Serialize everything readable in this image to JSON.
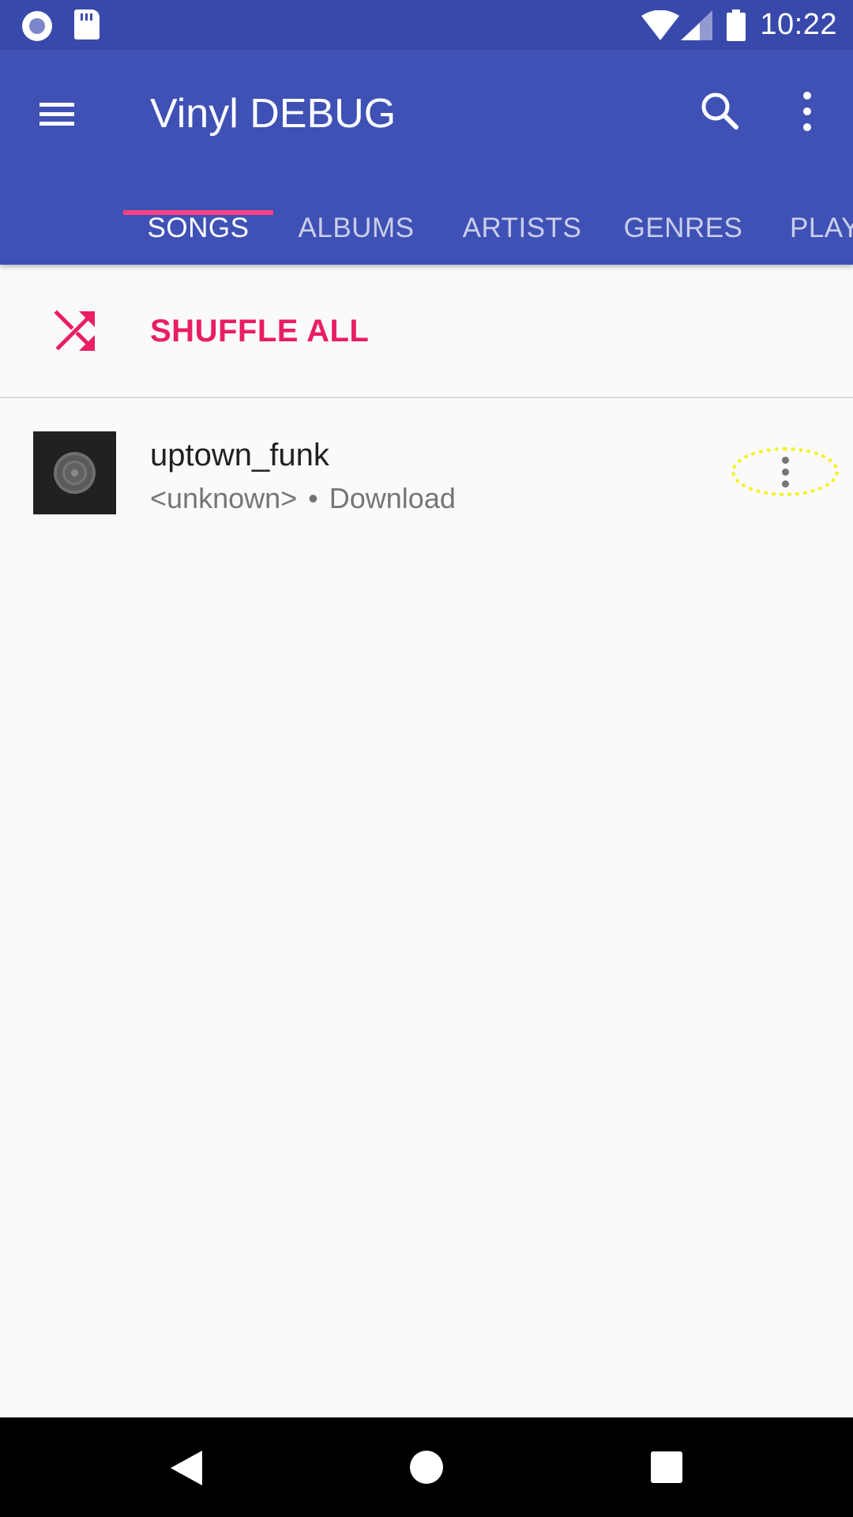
{
  "status_bar": {
    "time": "10:22",
    "left_icons": [
      "media-notification-icon",
      "sd-card-icon"
    ],
    "right_icons": [
      "wifi-icon",
      "signal-icon",
      "battery-icon"
    ]
  },
  "app_bar": {
    "title": "Vinyl DEBUG",
    "menu_icon": "menu-icon",
    "search_icon": "search-icon",
    "overflow_icon": "more-vert-icon",
    "tabs": [
      {
        "label": "SONGS",
        "active": true
      },
      {
        "label": "ALBUMS",
        "active": false
      },
      {
        "label": "ARTISTS",
        "active": false
      },
      {
        "label": "GENRES",
        "active": false
      },
      {
        "label": "PLAYLISTS",
        "active": false
      }
    ]
  },
  "shuffle": {
    "label": "SHUFFLE ALL",
    "icon": "shuffle-icon"
  },
  "songs": [
    {
      "title": "uptown_funk",
      "artist": "<unknown>",
      "separator": "•",
      "album": "Download",
      "menu_icon": "more-vert-icon"
    }
  ],
  "nav_bar": {
    "icons": [
      "back-icon",
      "home-icon",
      "recents-icon"
    ]
  },
  "colors": {
    "status_bar": "#3949ab",
    "primary": "#3f51b5",
    "accent": "#e91e63",
    "tab_indicator": "#ff4081",
    "highlight": "#f5f126",
    "background": "#fafafa"
  }
}
